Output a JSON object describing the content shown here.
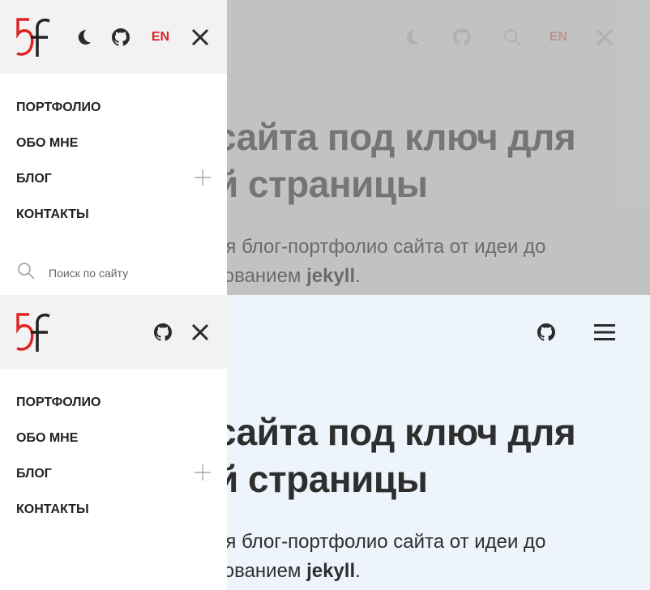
{
  "brand": {
    "logo_name": "5f-logo",
    "accent_color": "#e02424"
  },
  "hero": {
    "title_line1": "сайта под ключ для",
    "title_line2": "й страницы",
    "subtitle_line1": "ия блог-портфолио сайта от идеи до",
    "subtitle_line2_prefix": "зованием ",
    "subtitle_line2_bold": "jekyll",
    "subtitle_line2_suffix": "."
  },
  "top_view": {
    "menu": {
      "actions": {
        "theme_icon": "moon-icon",
        "github_icon": "github-icon",
        "lang_label": "EN",
        "close_icon": "close-icon"
      },
      "items": [
        {
          "label": "ПОРТФОЛИО"
        },
        {
          "label": "ОБО МНЕ"
        },
        {
          "label": "БЛОГ",
          "expandable": true
        },
        {
          "label": "КОНТАКТЫ"
        }
      ],
      "search": {
        "placeholder": "Поиск по сайту",
        "icon": "search-icon"
      }
    },
    "background_header": {
      "icons": [
        "moon-icon",
        "github-icon",
        "search-icon"
      ],
      "lang_label": "EN",
      "close_icon": "close-icon"
    }
  },
  "bottom_view": {
    "menu": {
      "actions": {
        "github_icon": "github-icon",
        "close_icon": "close-icon"
      },
      "items": [
        {
          "label": "ПОРТФОЛИО"
        },
        {
          "label": "ОБО МНЕ"
        },
        {
          "label": "БЛОГ",
          "expandable": true
        },
        {
          "label": "КОНТАКТЫ"
        }
      ]
    },
    "background_header": {
      "icons": [
        "github-icon",
        "hamburger-menu-icon"
      ]
    }
  }
}
